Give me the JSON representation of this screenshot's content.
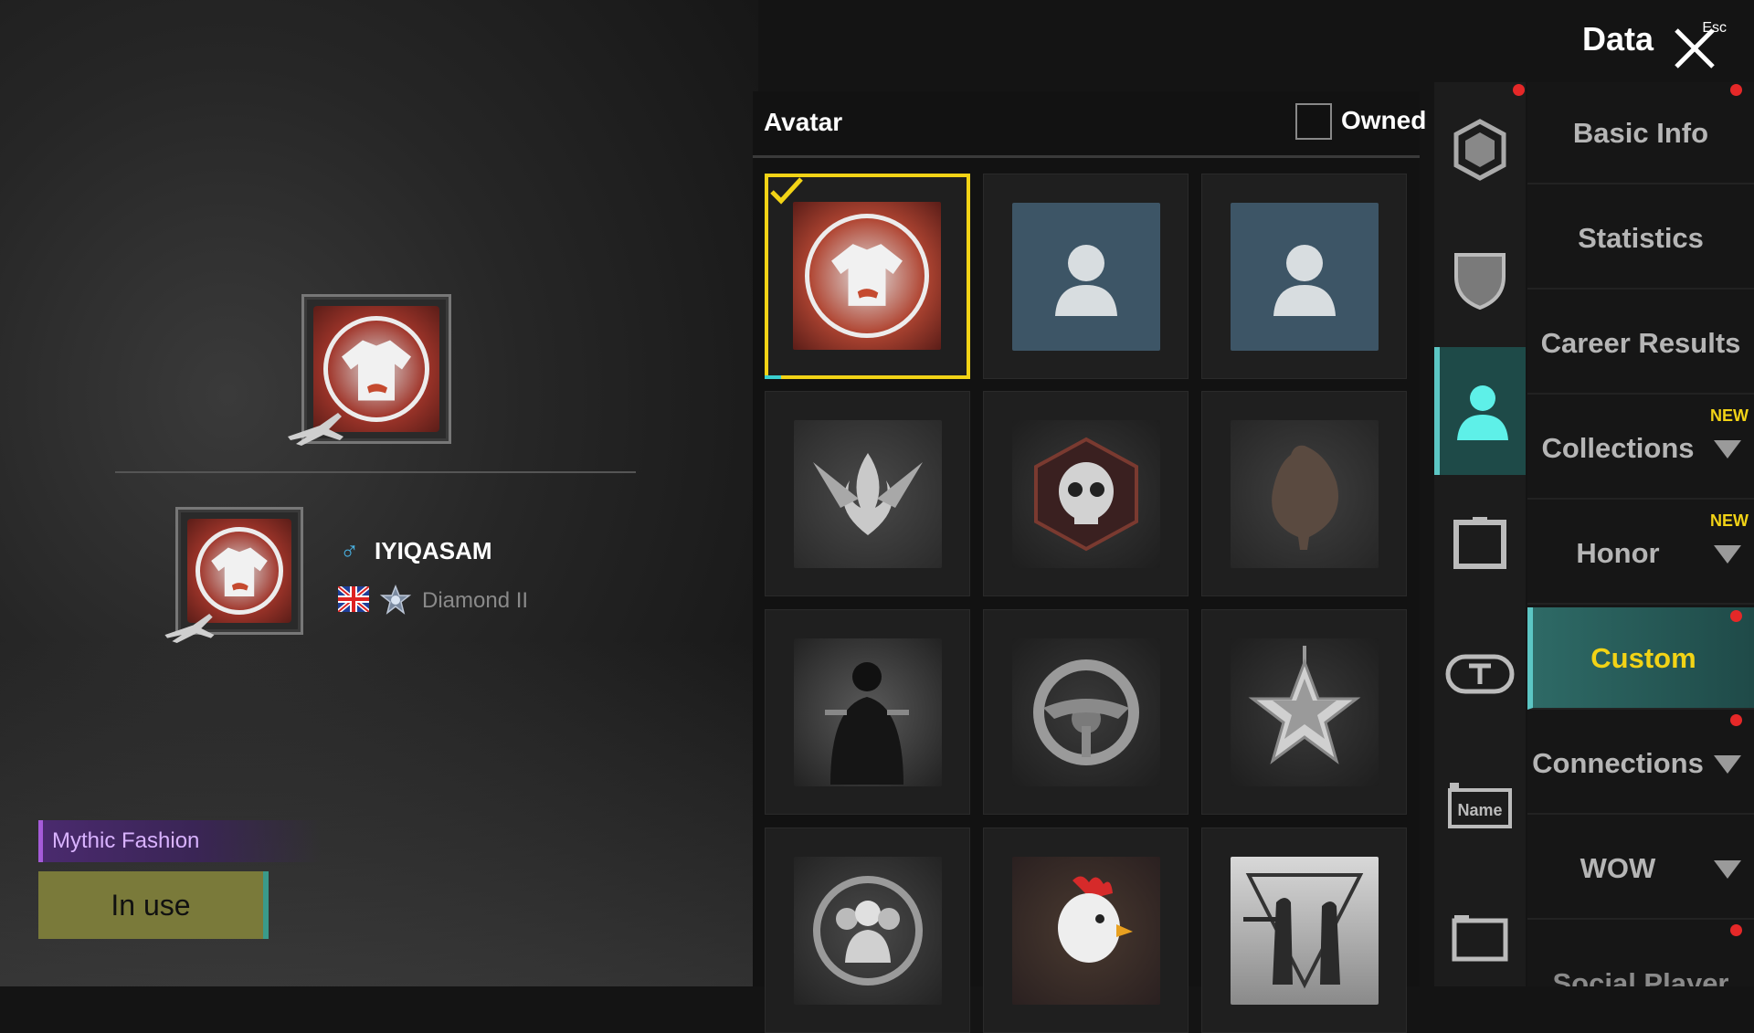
{
  "header": {
    "title": "Data",
    "close_hint": "Esc"
  },
  "preview": {
    "player_name": "IYIQASAM",
    "gender_symbol": "♂",
    "rank": "Diamond II",
    "item_tier": "Mythic Fashion",
    "status_button": "In use"
  },
  "panel": {
    "title": "Avatar",
    "owned_label": "Owned",
    "owned_checked": false,
    "grid": [
      {
        "kind": "shirt-avatar",
        "selected": true
      },
      {
        "kind": "default-silhouette"
      },
      {
        "kind": "default-silhouette"
      },
      {
        "kind": "winged-flame-emblem"
      },
      {
        "kind": "skull-hexagon-emblem"
      },
      {
        "kind": "chicken-silhouette-emblem"
      },
      {
        "kind": "gunman-emblem"
      },
      {
        "kind": "steering-wheel-emblem"
      },
      {
        "kind": "star-medal-emblem"
      },
      {
        "kind": "squad-emblem"
      },
      {
        "kind": "rooster-emblem"
      },
      {
        "kind": "duo-shooters-emblem"
      }
    ]
  },
  "icon_tabs": [
    {
      "icon": "hexagon-frame-icon"
    },
    {
      "icon": "shield-badge-icon"
    },
    {
      "icon": "avatar-person-icon",
      "active": true
    },
    {
      "icon": "frame-icon"
    },
    {
      "icon": "title-t-icon"
    },
    {
      "icon": "name-tag-icon"
    },
    {
      "icon": "card-frame-icon"
    }
  ],
  "menu": {
    "items": [
      {
        "label": "Basic Info"
      },
      {
        "label": "Statistics"
      },
      {
        "label": "Career Results"
      },
      {
        "label": "Collections",
        "badge": "NEW",
        "arrow": true
      },
      {
        "label": "Honor",
        "badge": "NEW",
        "arrow": true
      },
      {
        "label": "Custom",
        "active": true
      },
      {
        "label": "Connections",
        "arrow": true
      },
      {
        "label": "WOW",
        "arrow": true
      }
    ],
    "cut_item": "Social Player Card"
  },
  "colors": {
    "accent_yellow": "#f2d316",
    "accent_teal": "#5cc6c4",
    "mythic_purple": "#a55bd9",
    "notification_red": "#e52828"
  }
}
